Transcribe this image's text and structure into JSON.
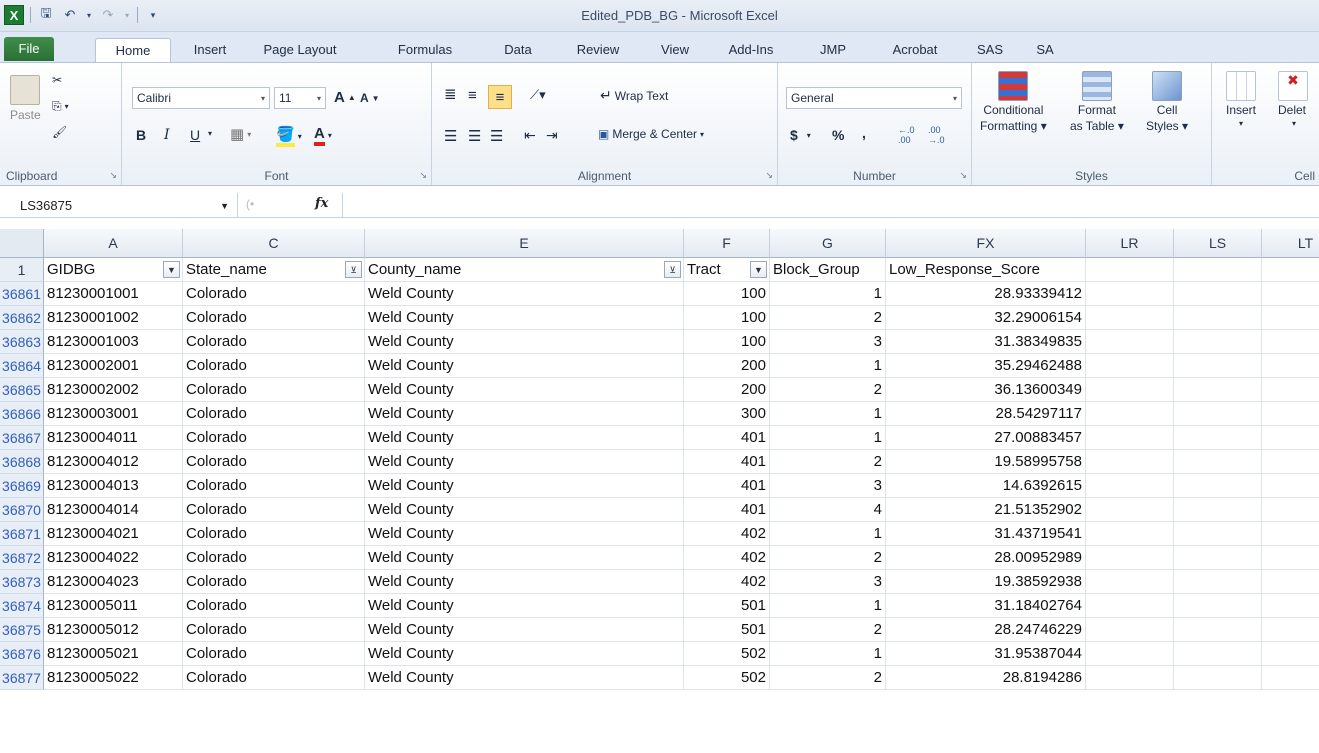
{
  "window": {
    "title": "Edited_PDB_BG - Microsoft Excel",
    "logo": "X"
  },
  "tabs": [
    "File",
    "Home",
    "Insert",
    "Page Layout",
    "Formulas",
    "Data",
    "Review",
    "View",
    "Add-Ins",
    "JMP",
    "Acrobat",
    "SAS",
    "SA"
  ],
  "ribbon": {
    "clipboard": {
      "label": "Clipboard",
      "paste": "Paste"
    },
    "font": {
      "label": "Font",
      "family": "Calibri",
      "size": "11",
      "bold": "B",
      "italic": "I",
      "underline": "U",
      "grow": "A",
      "shrink": "A",
      "color_letter": "A"
    },
    "alignment": {
      "label": "Alignment",
      "wrap": "Wrap Text",
      "merge": "Merge & Center"
    },
    "number": {
      "label": "Number",
      "format": "General",
      "currency": "$",
      "percent": "%",
      "comma": ",",
      "inc": "←.0 .00",
      "dec": ".00 →.0"
    },
    "styles": {
      "label": "Styles",
      "conditional1": "Conditional",
      "conditional2": "Formatting",
      "format_table1": "Format",
      "format_table2": "as Table",
      "cell_styles1": "Cell",
      "cell_styles2": "Styles"
    },
    "cells": {
      "label": "Cell",
      "insert": "Insert",
      "delete": "Delet"
    }
  },
  "formula_bar": {
    "name_box": "LS36875",
    "fx": "fx",
    "content": ""
  },
  "columns": [
    {
      "letter": "A",
      "header": "GIDBG"
    },
    {
      "letter": "C",
      "header": "State_name"
    },
    {
      "letter": "E",
      "header": "County_name"
    },
    {
      "letter": "F",
      "header": "Tract"
    },
    {
      "letter": "G",
      "header": "Block_Group"
    },
    {
      "letter": "FX",
      "header": "Low_Response_Score"
    },
    {
      "letter": "LR",
      "header": ""
    },
    {
      "letter": "LS",
      "header": ""
    },
    {
      "letter": "LT",
      "header": ""
    }
  ],
  "header_row_number": "1",
  "rows": [
    [
      "36861",
      "81230001001",
      "Colorado",
      "Weld County",
      "100",
      "1",
      "28.93339412"
    ],
    [
      "36862",
      "81230001002",
      "Colorado",
      "Weld County",
      "100",
      "2",
      "32.29006154"
    ],
    [
      "36863",
      "81230001003",
      "Colorado",
      "Weld County",
      "100",
      "3",
      "31.38349835"
    ],
    [
      "36864",
      "81230002001",
      "Colorado",
      "Weld County",
      "200",
      "1",
      "35.29462488"
    ],
    [
      "36865",
      "81230002002",
      "Colorado",
      "Weld County",
      "200",
      "2",
      "36.13600349"
    ],
    [
      "36866",
      "81230003001",
      "Colorado",
      "Weld County",
      "300",
      "1",
      "28.54297117"
    ],
    [
      "36867",
      "81230004011",
      "Colorado",
      "Weld County",
      "401",
      "1",
      "27.00883457"
    ],
    [
      "36868",
      "81230004012",
      "Colorado",
      "Weld County",
      "401",
      "2",
      "19.58995758"
    ],
    [
      "36869",
      "81230004013",
      "Colorado",
      "Weld County",
      "401",
      "3",
      "14.6392615"
    ],
    [
      "36870",
      "81230004014",
      "Colorado",
      "Weld County",
      "401",
      "4",
      "21.51352902"
    ],
    [
      "36871",
      "81230004021",
      "Colorado",
      "Weld County",
      "402",
      "1",
      "31.43719541"
    ],
    [
      "36872",
      "81230004022",
      "Colorado",
      "Weld County",
      "402",
      "2",
      "28.00952989"
    ],
    [
      "36873",
      "81230004023",
      "Colorado",
      "Weld County",
      "402",
      "3",
      "19.38592938"
    ],
    [
      "36874",
      "81230005011",
      "Colorado",
      "Weld County",
      "501",
      "1",
      "31.18402764"
    ],
    [
      "36875",
      "81230005012",
      "Colorado",
      "Weld County",
      "501",
      "2",
      "28.24746229"
    ],
    [
      "36876",
      "81230005021",
      "Colorado",
      "Weld County",
      "502",
      "1",
      "31.95387044"
    ],
    [
      "36877",
      "81230005022",
      "Colorado",
      "Weld County",
      "502",
      "2",
      "28.8194286"
    ]
  ]
}
